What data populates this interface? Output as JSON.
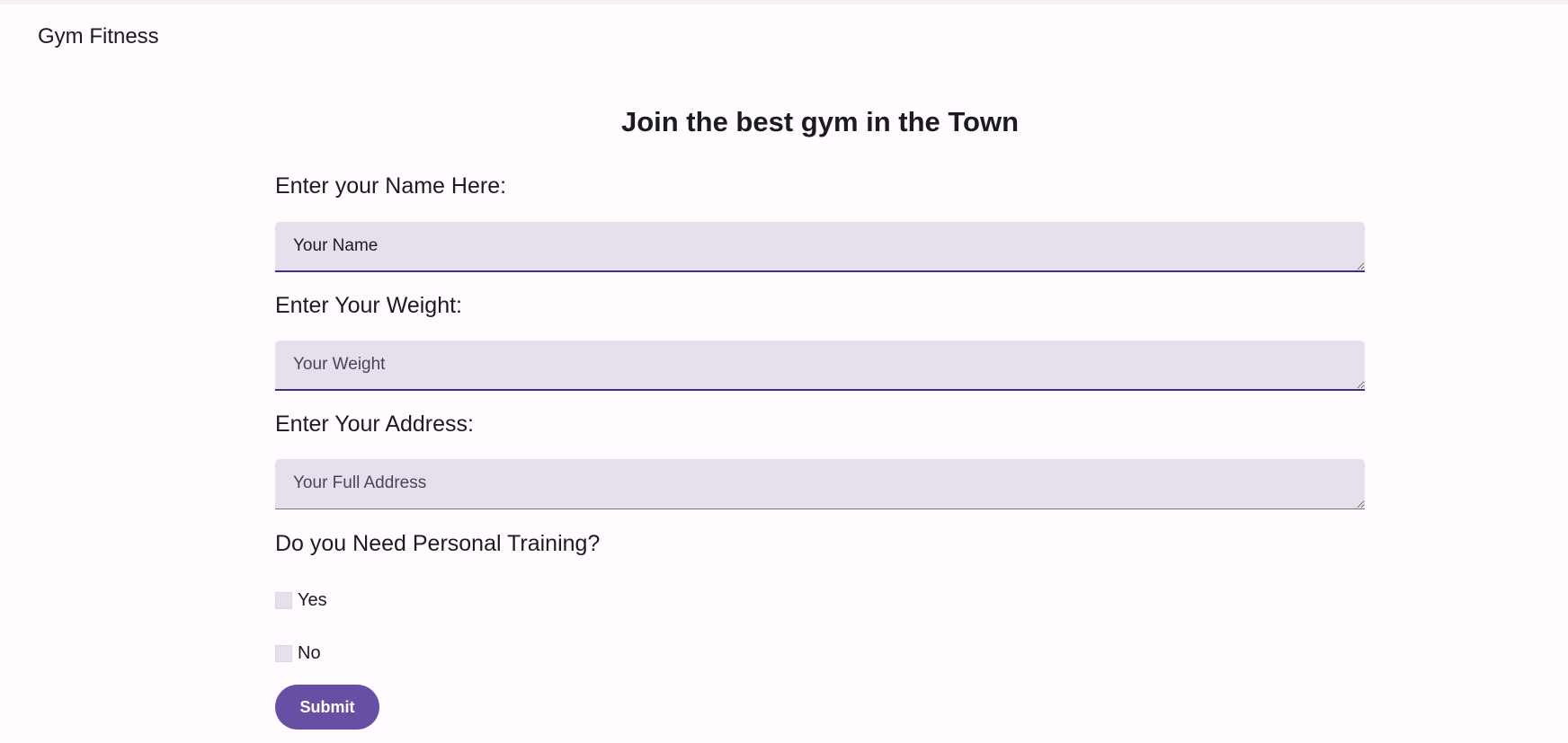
{
  "header": {
    "brand": "Gym Fitness"
  },
  "form": {
    "title": "Join the best gym in the Town",
    "name_label": "Enter your Name Here:",
    "name_placeholder": "Your Name",
    "weight_label": "Enter Your Weight:",
    "weight_placeholder": "Your Weight",
    "address_label": "Enter Your Address:",
    "address_placeholder": "Your Full Address",
    "training_question": "Do you Need Personal Training?",
    "options": [
      {
        "label": "Yes",
        "checked": false
      },
      {
        "label": "No",
        "checked": false
      }
    ],
    "submit_label": "Submit"
  },
  "colors": {
    "background": "#fffbff",
    "field_background": "#e6e0ec",
    "primary": "#6750a4",
    "active_underline": "#3b2f86"
  }
}
